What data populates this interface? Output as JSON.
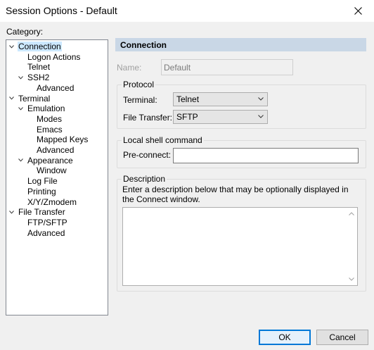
{
  "window": {
    "title": "Session Options - Default",
    "close_icon": "close-icon"
  },
  "category_label": "Category:",
  "tree": [
    {
      "label": "Connection",
      "depth": 0,
      "expanded": true,
      "selected": true
    },
    {
      "label": "Logon Actions",
      "depth": 1
    },
    {
      "label": "Telnet",
      "depth": 1
    },
    {
      "label": "SSH2",
      "depth": 1,
      "expanded": true
    },
    {
      "label": "Advanced",
      "depth": 2
    },
    {
      "label": "Terminal",
      "depth": 0,
      "expanded": true
    },
    {
      "label": "Emulation",
      "depth": 1,
      "expanded": true
    },
    {
      "label": "Modes",
      "depth": 2
    },
    {
      "label": "Emacs",
      "depth": 2
    },
    {
      "label": "Mapped Keys",
      "depth": 2
    },
    {
      "label": "Advanced",
      "depth": 2
    },
    {
      "label": "Appearance",
      "depth": 1,
      "expanded": true
    },
    {
      "label": "Window",
      "depth": 2
    },
    {
      "label": "Log File",
      "depth": 1
    },
    {
      "label": "Printing",
      "depth": 1
    },
    {
      "label": "X/Y/Zmodem",
      "depth": 1
    },
    {
      "label": "File Transfer",
      "depth": 0,
      "expanded": true
    },
    {
      "label": "FTP/SFTP",
      "depth": 1
    },
    {
      "label": "Advanced",
      "depth": 1
    }
  ],
  "panel": {
    "header": "Connection",
    "name_label": "Name:",
    "name_value": "Default",
    "protocol": {
      "legend": "Protocol",
      "terminal_label": "Terminal:",
      "terminal_value": "Telnet",
      "file_transfer_label": "File Transfer:",
      "file_transfer_value": "SFTP"
    },
    "local_shell": {
      "legend": "Local shell command",
      "preconnect_label": "Pre-connect:",
      "preconnect_value": ""
    },
    "description": {
      "legend": "Description",
      "hint": "Enter a description below that may be optionally displayed in the Connect window.",
      "value": ""
    }
  },
  "buttons": {
    "ok": "OK",
    "cancel": "Cancel"
  },
  "colors": {
    "header_bg": "#c9d7e6",
    "selection_bg": "#cce8ff",
    "default_button_border": "#0078d7"
  }
}
